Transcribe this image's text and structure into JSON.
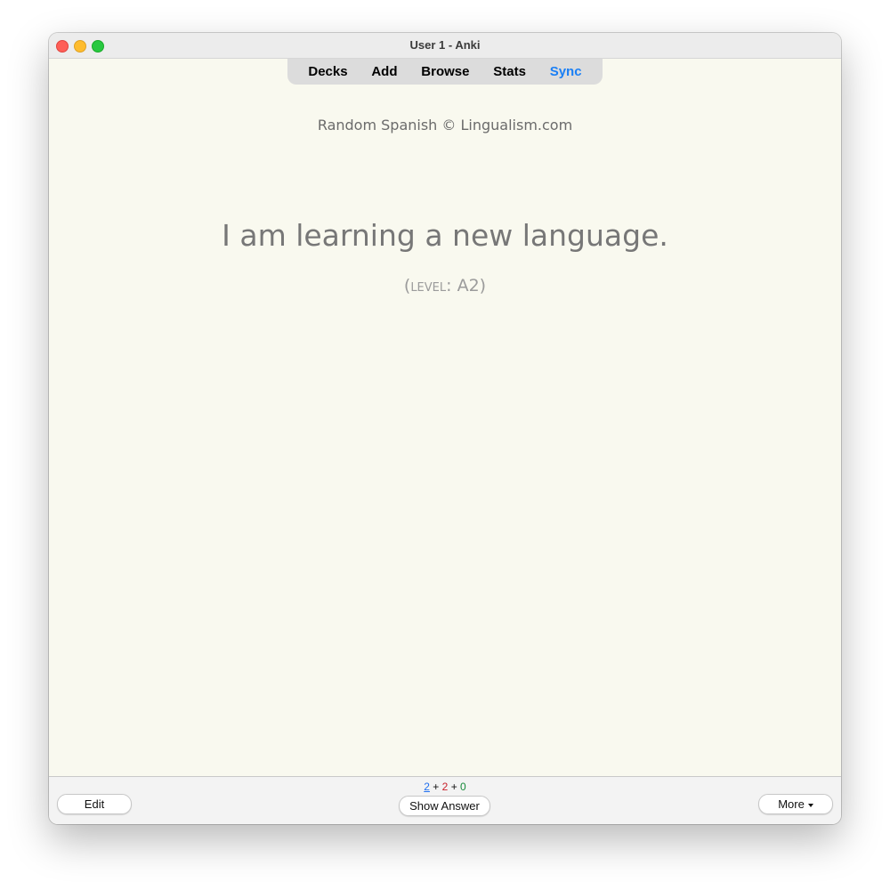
{
  "window": {
    "title": "User 1 - Anki"
  },
  "toolbar": {
    "items": [
      "Decks",
      "Add",
      "Browse",
      "Stats",
      "Sync"
    ],
    "sync_color": "#1a7ff5"
  },
  "card": {
    "deck_credit": "Random Spanish © Lingualism.com",
    "sentence": "I am learning a new language.",
    "level_open": "(",
    "level_key": "level",
    "level_sep": ": ",
    "level_value": "A2",
    "level_close": ")"
  },
  "bottom": {
    "edit_label": "Edit",
    "show_answer_label": "Show Answer",
    "more_label": "More",
    "counts": {
      "new": "2",
      "learning": "2",
      "review": "0",
      "plus": "+",
      "new_color": "#1f6ff0",
      "learning_color": "#c8202a",
      "review_color": "#168a3a"
    }
  }
}
